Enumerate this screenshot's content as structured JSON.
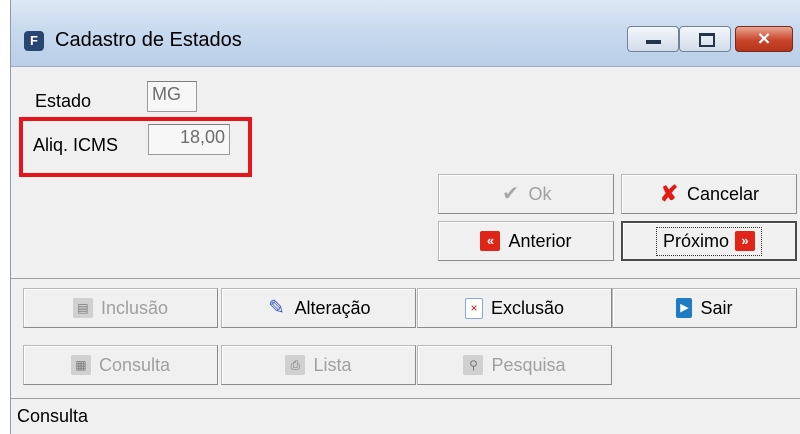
{
  "window": {
    "icon_letter": "F",
    "title": "Cadastro de Estados",
    "controls": {
      "minimize": "minimize",
      "maximize": "maximize",
      "close": "×"
    }
  },
  "form": {
    "estado": {
      "label": "Estado",
      "value": "MG"
    },
    "aliq_icms": {
      "label": "Aliq. ICMS",
      "value": "18,00"
    }
  },
  "nav_buttons": {
    "ok": {
      "label": "Ok",
      "icon": "check-icon"
    },
    "cancelar": {
      "label": "Cancelar",
      "icon": "red-x-icon"
    },
    "anterior": {
      "label": "Anterior",
      "icon": "double-left-icon",
      "glyph": "«"
    },
    "proximo": {
      "label": "Próximo",
      "icon": "double-right-icon",
      "glyph": "»"
    }
  },
  "actions": {
    "inclusao": {
      "label": "Inclusão",
      "icon": "add-document-icon"
    },
    "alteracao": {
      "label": "Alteração",
      "icon": "edit-pencil-icon"
    },
    "exclusao": {
      "label": "Exclusão",
      "icon": "delete-document-icon"
    },
    "sair": {
      "label": "Sair",
      "icon": "exit-door-icon"
    },
    "consulta": {
      "label": "Consulta",
      "icon": "query-card-icon"
    },
    "lista": {
      "label": "Lista",
      "icon": "printer-icon"
    },
    "pesquisa": {
      "label": "Pesquisa",
      "icon": "search-magnifier-icon"
    }
  },
  "status": {
    "text": "Consulta"
  },
  "colors": {
    "highlight": "#e8141c",
    "titlebar": "#c8daee",
    "close": "#c8452c"
  }
}
